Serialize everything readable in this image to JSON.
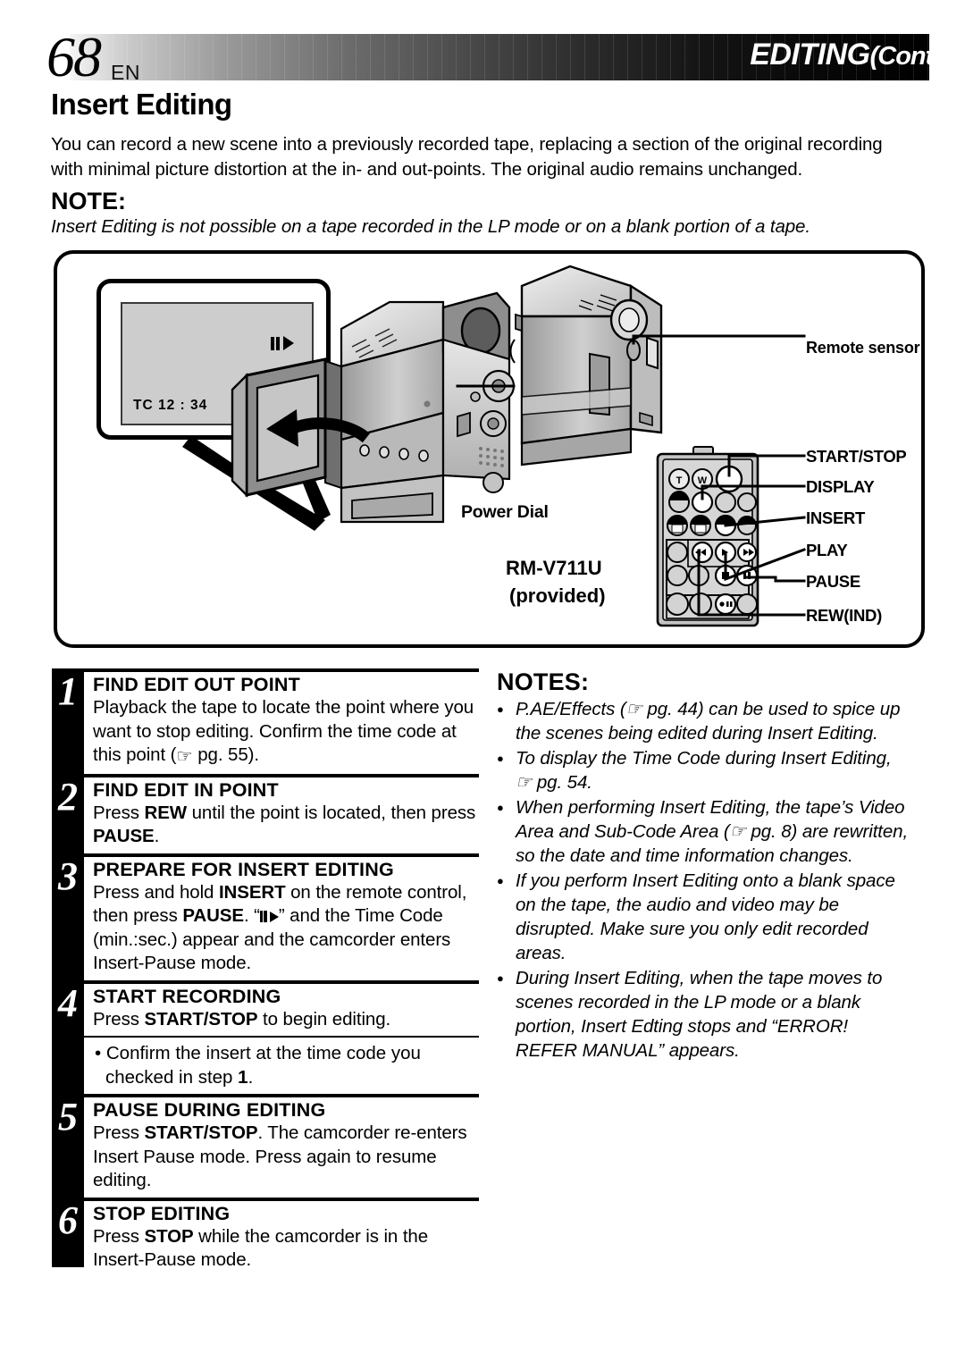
{
  "header": {
    "page_number": "68",
    "language_code": "EN",
    "title": "EDITING",
    "title_cont": "(Cont.)"
  },
  "section": {
    "title": "Insert Editing",
    "intro": "You can record a new scene into a previously recorded tape, replacing a section of the original recording with minimal picture distortion at the in- and out-points. The original audio remains unchanged.",
    "note_heading": "NOTE:",
    "note_text": "Insert Editing is not possible on a tape recorded in the LP mode or on a blank portion of a tape."
  },
  "illustration": {
    "lcd": {
      "time_code": "TC 12 : 34",
      "status_icon": "insert-pause-icon"
    },
    "callouts": {
      "remote_sensor": "Remote sensor",
      "power_dial": "Power Dial",
      "remote_model": "RM-V711U",
      "remote_provided": "(provided)"
    },
    "remote_buttons": [
      "START/STOP",
      "DISPLAY",
      "INSERT",
      "PLAY",
      "PAUSE",
      "REW(IND)"
    ],
    "remote_keys": {
      "tele": "T",
      "wide": "W"
    }
  },
  "steps": [
    {
      "number": "1",
      "title": "FIND EDIT OUT POINT",
      "body_1": "Playback the tape to locate the point where you want to stop editing. Confirm the time code at this point (",
      "body_2": " pg. 55)."
    },
    {
      "number": "2",
      "title": "FIND EDIT IN POINT",
      "body_1": "Press ",
      "bold_1": "REW",
      "body_2": " until the point is located, then press ",
      "bold_2": "PAUSE",
      "body_3": "."
    },
    {
      "number": "3",
      "title": "PREPARE FOR INSERT EDITING",
      "body_1": "Press and hold ",
      "bold_1": "INSERT",
      "body_2": " on the remote control, then press ",
      "bold_2": "PAUSE",
      "body_3": ". “",
      "body_4": "” and the Time Code (min.:sec.) appear and the camcorder enters Insert-Pause mode."
    },
    {
      "number": "4",
      "title": "START RECORDING",
      "body_1": "Press ",
      "bold_1": "START/STOP",
      "body_2": " to begin editing."
    },
    {
      "number": "",
      "title": "",
      "sub_1": "• Confirm the insert at the time code you checked in step ",
      "sub_bold": "1",
      "sub_2": "."
    },
    {
      "number": "5",
      "title": "PAUSE DURING EDITING",
      "body_1": "Press ",
      "bold_1": "START/STOP",
      "body_2": ". The camcorder re-enters Insert Pause mode. Press again to resume editing."
    },
    {
      "number": "6",
      "title": "STOP EDITING",
      "body_1": "Press ",
      "bold_1": "STOP",
      "body_2": " while the camcorder is in the Insert-Pause mode."
    }
  ],
  "notes": {
    "heading": "NOTES:",
    "items": [
      "P.AE/Effects (☞ pg. 44) can be used to spice up the scenes being edited during Insert Editing.",
      "To display the Time Code during Insert Editing, ☞ pg. 54.",
      "When performing Insert Editing, the tape’s Video Area and Sub-Code Area (☞ pg. 8) are rewritten, so the date and time information changes.",
      "If you perform Insert Editing onto a blank space on the tape, the audio and video may be disrupted. Make sure you only edit recorded areas.",
      "During Insert Editing, when the tape moves to scenes recorded in the LP mode or a blank portion, Insert Edting stops and “ERROR! REFER MANUAL” appears."
    ]
  },
  "colors": {
    "ink": "#000000",
    "lcd_screen": "#cdcdcd",
    "remote_body": "#d0d0d0",
    "camera_body": "#b8b8b8"
  }
}
